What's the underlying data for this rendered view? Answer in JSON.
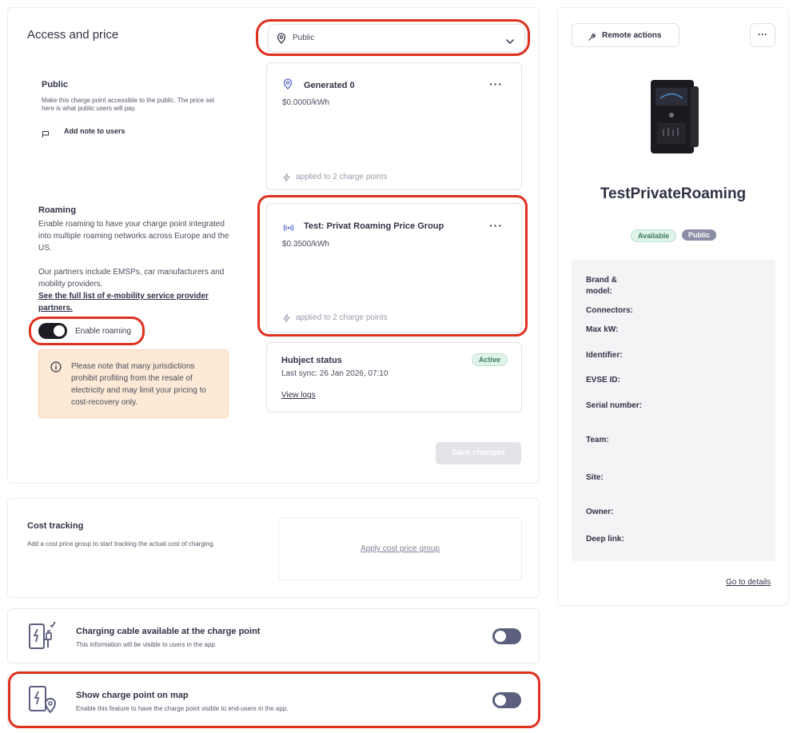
{
  "access": {
    "title": "Access and price",
    "dropdown_value": "Public",
    "public": {
      "title": "Public",
      "desc": "Make this charge point accessible to the public. The price set here is what public users will pay.",
      "add_note": "Add note to users"
    },
    "public_price": {
      "name": "Generated 0",
      "price": "$0.0000/kWh",
      "applied": "applied to 2 charge points"
    },
    "roaming": {
      "title": "Roaming",
      "desc1": "Enable roaming to have your charge point integrated into multiple roaming networks across Europe and the US.",
      "desc2": "Our partners include EMSPs, car manufacturers and mobility providers.",
      "link": "See the full list of e-mobility service provider partners.",
      "toggle_label": "Enable roaming",
      "toggle_on": true,
      "note": "Please note that many jurisdictions prohibit profiting from the resale of electricity and may limit your pricing to cost-recovery only."
    },
    "roaming_price": {
      "name": "Test: Privat Roaming Price Group",
      "price": "$0.3500/kWh",
      "applied": "applied to 2 charge points"
    },
    "hubject": {
      "title": "Hubject status",
      "sync": "Last sync: 26 Jan 2026, 07:10",
      "badge": "Active",
      "view_logs": "View logs"
    },
    "save_label": "Save changes"
  },
  "cost": {
    "title": "Cost tracking",
    "desc": "Add a cost price group to start tracking the actual cost of charging.",
    "apply": "Apply cost price group"
  },
  "cable": {
    "title": "Charging cable available at the charge point",
    "desc": "This information will be visible to users in the app.",
    "toggle_on": false
  },
  "map": {
    "title": "Show charge point on map",
    "desc": "Enable this feature to have the charge point visible to end-users in the app.",
    "toggle_on": false
  },
  "side": {
    "remote_actions": "Remote actions",
    "name": "TestPrivateRoaming",
    "badges": {
      "available": "Available",
      "public": "Public"
    },
    "specs": {
      "brand": "Brand & model:",
      "connectors": "Connectors:",
      "max_kw": "Max kW:",
      "identifier": "Identifier:",
      "evse": "EVSE ID:",
      "serial": "Serial number:",
      "team": "Team:",
      "site": "Site:",
      "owner": "Owner:",
      "deep_link": "Deep link:"
    },
    "go_details": "Go to details"
  },
  "colors": {
    "highlight": "#e0301e",
    "accent": "#5c5f7e",
    "active_bg": "#dff3ea",
    "warning_bg": "#fde9d6"
  }
}
